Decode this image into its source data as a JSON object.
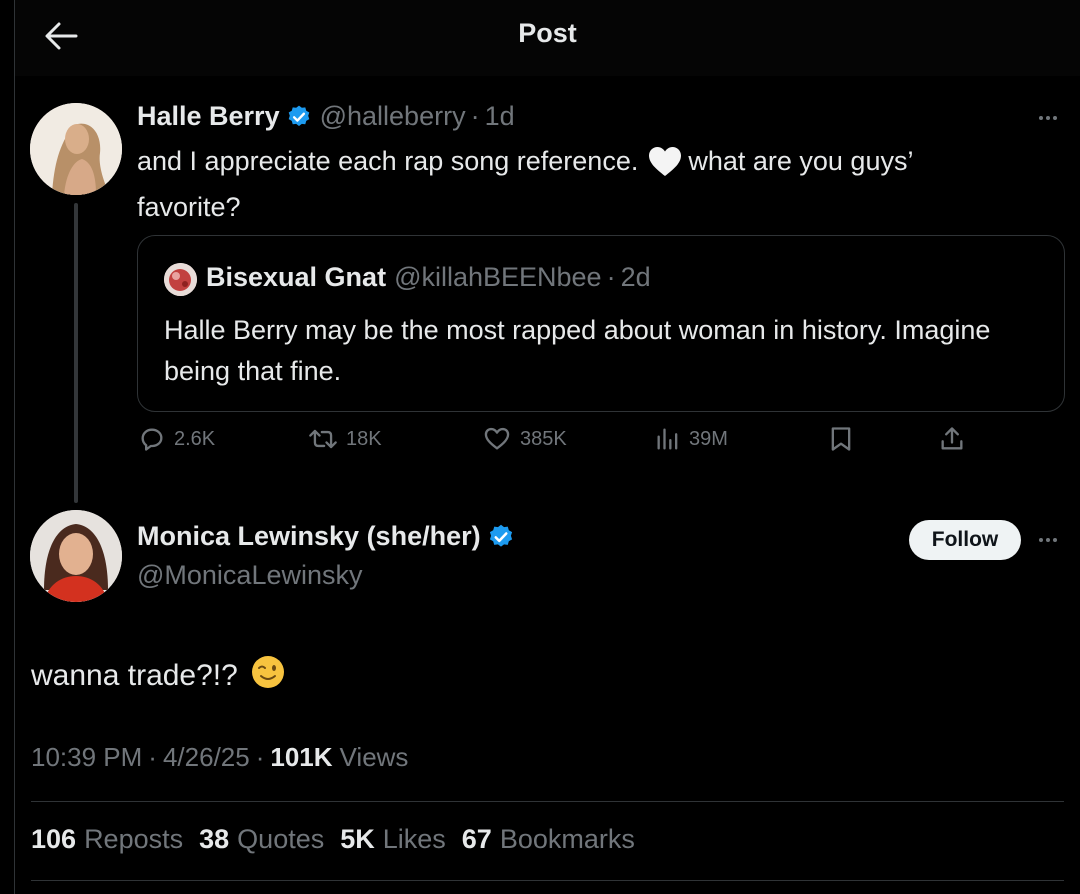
{
  "header": {
    "title": "Post",
    "back_icon": "arrow-left-icon"
  },
  "quoted_parent": {
    "author_name": "Halle Berry",
    "handle": "@halleberry",
    "time": "1d",
    "text_part1": "and I appreciate each rap song reference.",
    "emoji": "white-heart-icon",
    "text_part2": "what are you guys’ favorite?",
    "quote": {
      "author_name": "Bisexual Gnat",
      "handle": "@killahBEENbee",
      "time": "2d",
      "text": "Halle Berry may be the most rapped about woman in history. Imagine being that fine."
    },
    "actions": {
      "replies": "2.6K",
      "reposts": "18K",
      "likes": "385K",
      "views": "39M"
    }
  },
  "main_post": {
    "author_name": "Monica Lewinsky (she/her)",
    "handle": "@MonicaLewinsky",
    "follow_label": "Follow",
    "text": "wanna trade?!?",
    "emoji": "winking-face-icon",
    "time": "10:39 PM",
    "date": "4/26/25",
    "views_count": "101K",
    "views_label": "Views",
    "separator": "·"
  },
  "stats": [
    {
      "count": "106",
      "label": "Reposts"
    },
    {
      "count": "38",
      "label": "Quotes"
    },
    {
      "count": "5K",
      "label": "Likes"
    },
    {
      "count": "67",
      "label": "Bookmarks"
    }
  ],
  "colors": {
    "background": "#000000",
    "text": "#e7e9ea",
    "muted": "#71767b",
    "verified": "#1d9bf0",
    "border": "#2f3336"
  }
}
